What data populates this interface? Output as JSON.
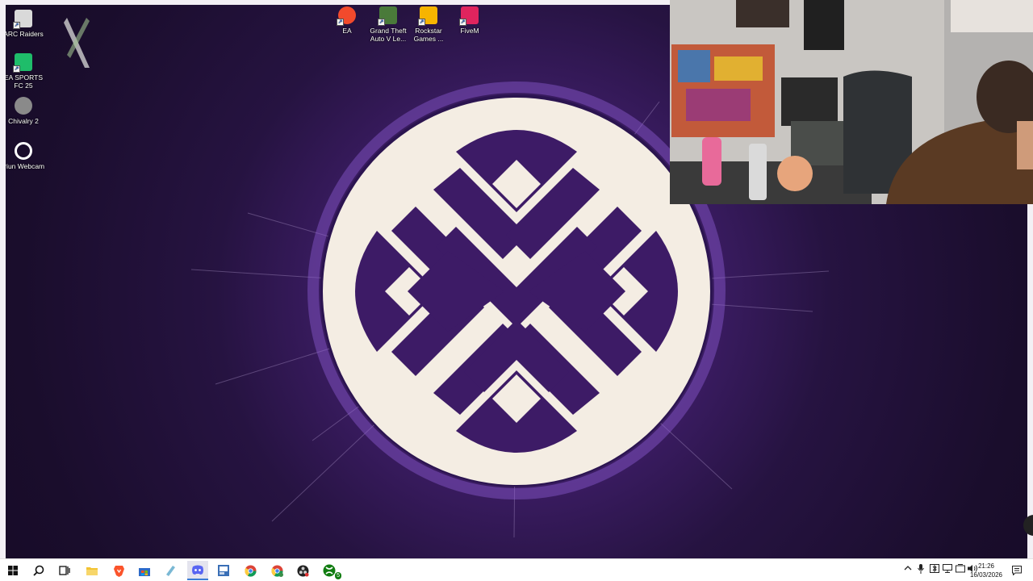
{
  "desktop_icons": [
    {
      "label": "ARC Raiders",
      "icon": "arc-raiders-icon",
      "color": "#d9d9d9"
    },
    {
      "label": "EA SPORTS FC 25",
      "icon": "ea-sports-fc-icon",
      "color": "#1fbd6a"
    },
    {
      "label": "Chivalry 2",
      "icon": "chivalry-icon",
      "color": "#8a8a8a"
    },
    {
      "label": "Iriun Webcam",
      "icon": "iriun-webcam-icon",
      "color": "#ffffff"
    },
    {
      "label": "EA",
      "icon": "ea-icon",
      "color": "#f24a2c"
    },
    {
      "label": "Grand Theft Auto V Le...",
      "icon": "gta-icon",
      "color": "#4a7a3a"
    },
    {
      "label": "Rockstar Games ...",
      "icon": "rockstar-icon",
      "color": "#f6b400"
    },
    {
      "label": "FiveM",
      "icon": "fivem-icon",
      "color": "#e0245e"
    }
  ],
  "wallpaper": {
    "logo": "emblem-logo",
    "circle_color": "#f4ede3",
    "glyph_color": "#3d1b66"
  },
  "taskbar": {
    "apps": [
      "windows-start-icon",
      "search-icon",
      "task-view-icon",
      "file-explorer-icon",
      "brave-browser-icon",
      "store-icon",
      "notepad-icon",
      "discord-icon",
      "vscode-icon",
      "chrome-icon",
      "chrome-profile-icon",
      "obs-icon",
      "xbox-icon"
    ],
    "xbox_badge": "5",
    "tray_icons": [
      "chevron-up-icon",
      "microphone-icon",
      "bluetooth-icon",
      "network-icon",
      "wifi-icon",
      "volume-icon"
    ],
    "time": "21:26",
    "date": "16/03/2026"
  }
}
